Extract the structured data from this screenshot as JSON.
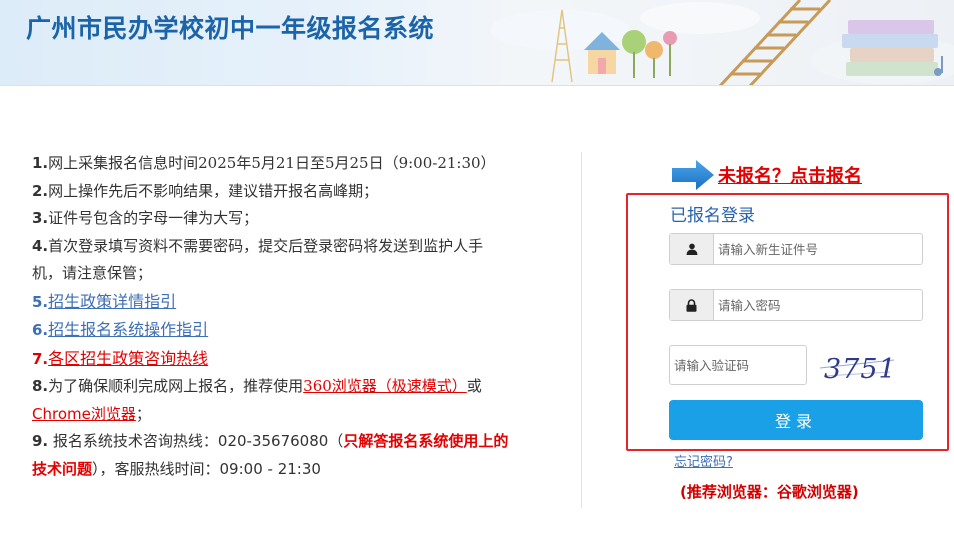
{
  "header": {
    "title": "广州市民办学校初中一年级报名系统"
  },
  "notices": {
    "n1": "1.",
    "t1": "网上采集报名信息时间2025年5月21日至5月25日（9:00-21:30）",
    "n2": "2.",
    "t2": "网上操作先后不影响结果，建议错开报名高峰期；",
    "n3": "3.",
    "t3": "证件号包含的字母一律为大写；",
    "n4": "4.",
    "t4": "首次登录填写资料不需要密码，提交后登录密码将发送到监护人手机，请注意保管；",
    "n5": "5.",
    "link5": "招生政策详情指引",
    "n6": "6.",
    "link6": "招生报名系统操作指引",
    "n7": "7.",
    "link7": "各区招生政策咨询热线",
    "n8": "8.",
    "t8a": "为了确保顺利完成网上报名，推荐使用",
    "link8a": "360浏览器（极速模式）",
    "t8b": "或",
    "link8b": "Chrome浏览器",
    "t8c": "；",
    "n9": "9.",
    "t9a": " 报名系统技术咨询热线：020-35676080（",
    "t9b": "只解答报名系统使用上的技术问题",
    "t9c": "），客服热线时间：09:00 - 21:30"
  },
  "register": {
    "link_text": "未报名？点击报名"
  },
  "login": {
    "title": "已报名登录",
    "id_placeholder": "请输入新生证件号",
    "password_placeholder": "请输入密码",
    "captcha_placeholder": "请输入验证码",
    "captcha_text": "3751",
    "button_label": "登录",
    "forgot_label": "忘记密码?",
    "browser_tip": "(推荐浏览器：谷歌浏览器)"
  },
  "colors": {
    "title_blue": "#1b64a9",
    "link_blue": "#3d6fb6",
    "alert_red": "#e50000",
    "button_blue": "#1aa0e6",
    "box_border_red": "#e8232b"
  },
  "icons": {
    "id_addon": "user-icon",
    "password_addon": "lock-icon",
    "register_pointer": "arrow-right-icon"
  }
}
